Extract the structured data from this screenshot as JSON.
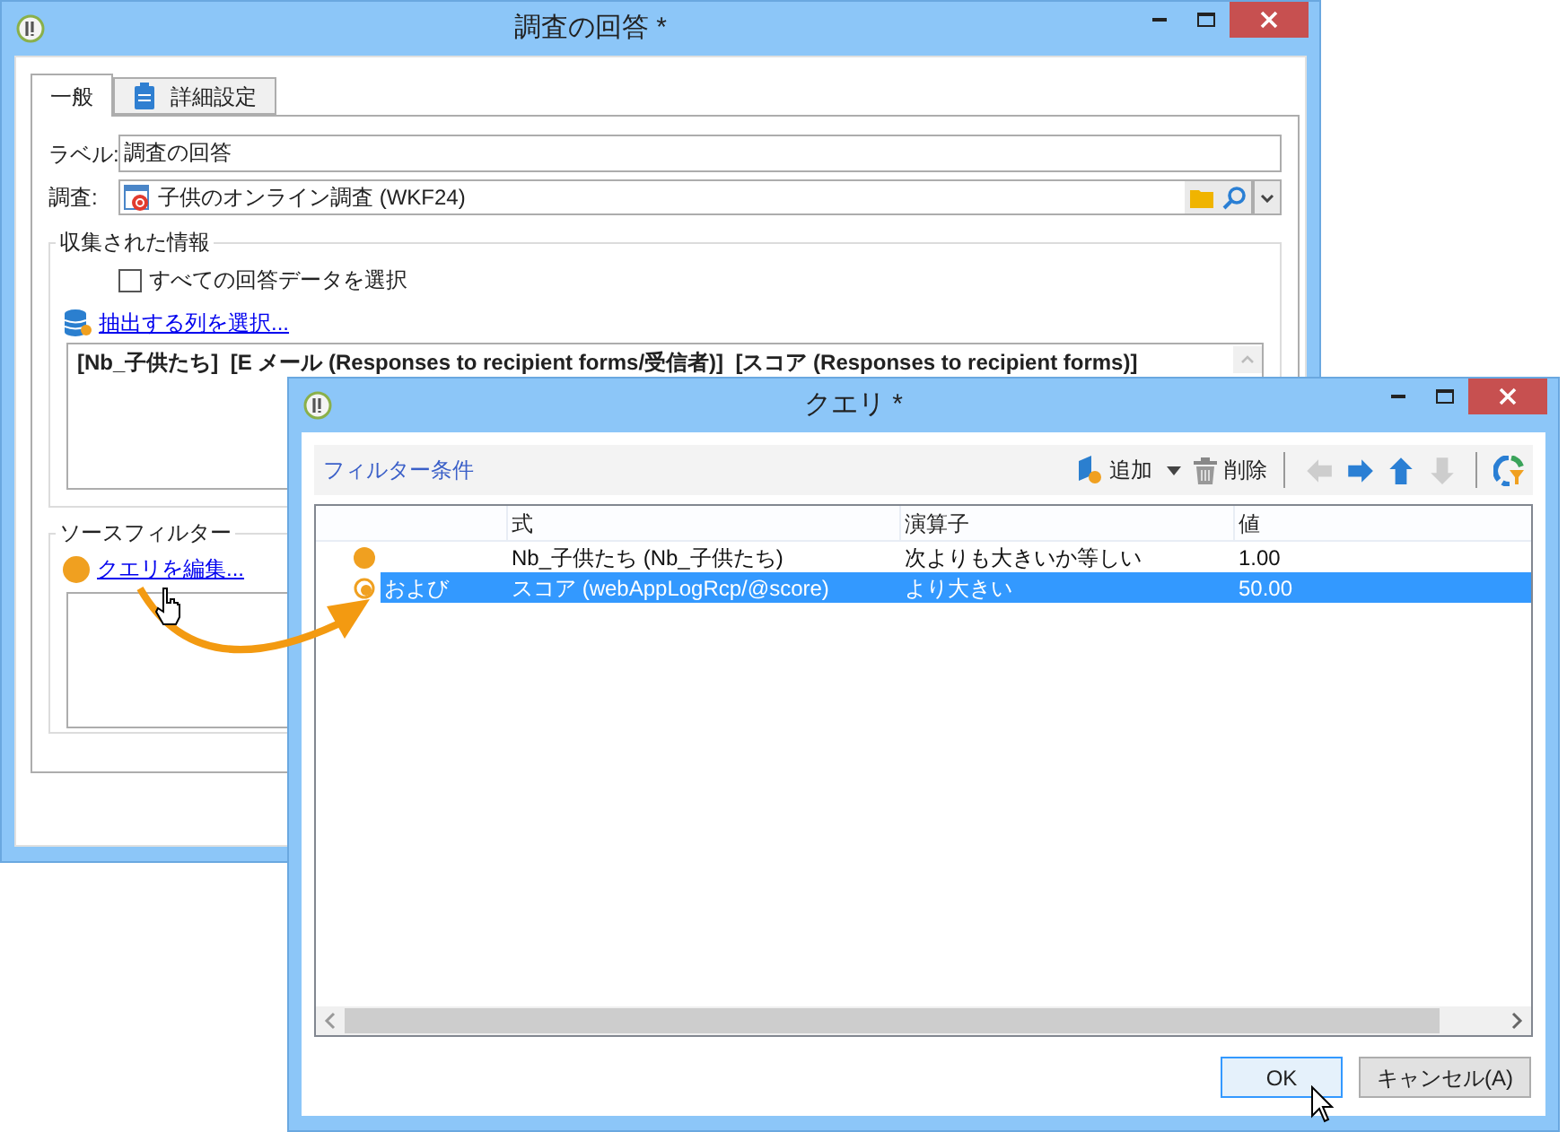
{
  "main_window": {
    "title": "調査の回答 *",
    "tabs": [
      {
        "label": "一般",
        "selected": true
      },
      {
        "label": "詳細設定",
        "selected": false
      }
    ],
    "label_field": {
      "label": "ラベル:",
      "value": "調査の回答"
    },
    "survey_field": {
      "label": "調査:",
      "value": "子供のオンライン調査 (WKF24)"
    },
    "collected_info": {
      "title": "収集された情報",
      "select_all": {
        "label": "すべての回答データを選択",
        "checked": false
      },
      "link": "抽出する列を選択...",
      "columns_text": "[Nb_子供たち]  [E メール (Responses to recipient forms/受信者)]  [スコア (Responses to recipient forms)]"
    },
    "source_filter": {
      "title": "ソースフィルター",
      "link": "クエリを編集..."
    }
  },
  "query_window": {
    "title": "クエリ *",
    "toolbar": {
      "title": "フィルター条件",
      "add": "追加",
      "delete": "削除",
      "nav": [
        {
          "kind": "left",
          "disabled": true
        },
        {
          "kind": "right",
          "disabled": false
        },
        {
          "kind": "up",
          "disabled": false
        },
        {
          "kind": "down",
          "disabled": true
        }
      ]
    },
    "table": {
      "columns": [
        "式",
        "演算子",
        "値"
      ],
      "rows": [
        {
          "kind": "solid",
          "selected": false,
          "expression": "Nb_子供たち (Nb_子供たち)",
          "operator": "次よりも大きいか等しい",
          "value": "1.00"
        },
        {
          "kind": "partial",
          "selected": true,
          "logic": "および",
          "expression": "スコア (webAppLogRcp/@score)",
          "operator": "より大きい",
          "value": "50.00"
        }
      ]
    },
    "buttons": [
      {
        "label": "OK",
        "default": true
      },
      {
        "label": "キャンセル(A)",
        "default": false
      }
    ]
  }
}
